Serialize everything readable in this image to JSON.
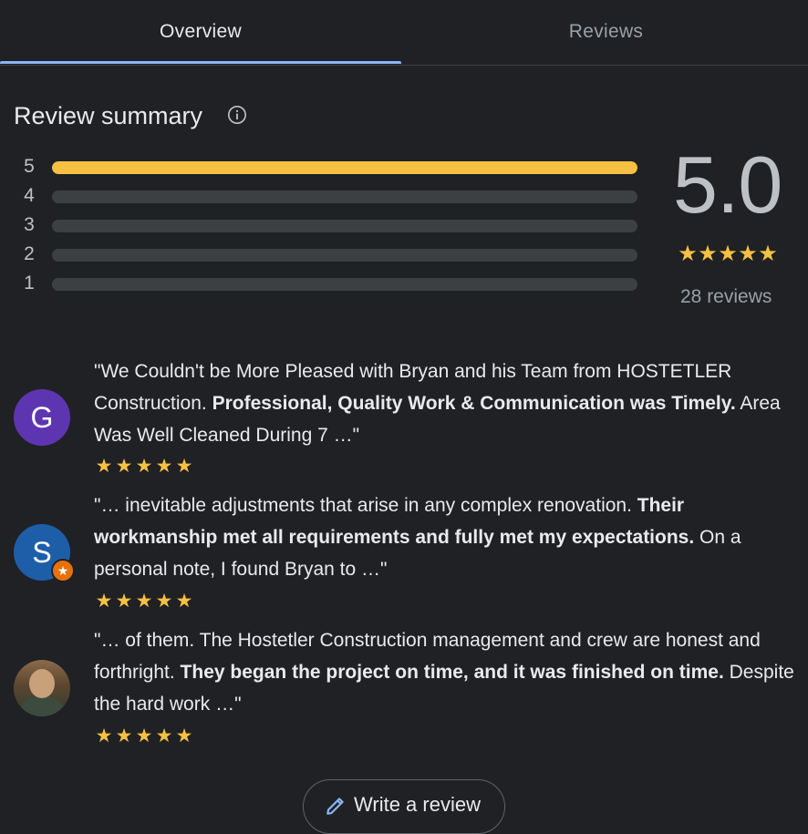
{
  "tabs": [
    {
      "label": "Overview",
      "selected": true
    },
    {
      "label": "Reviews",
      "selected": false
    }
  ],
  "summary": {
    "title": "Review summary",
    "info_icon": "info-icon",
    "rating": "5.0",
    "stars": 5,
    "review_count": "28 reviews",
    "distribution": [
      {
        "label": "5",
        "fraction": 1.0
      },
      {
        "label": "4",
        "fraction": 0
      },
      {
        "label": "3",
        "fraction": 0
      },
      {
        "label": "2",
        "fraction": 0
      },
      {
        "label": "1",
        "fraction": 0
      }
    ],
    "colors": {
      "bar_fill": "#f6c142",
      "bar_track": "#3c4043",
      "star": "#f6c142"
    }
  },
  "reviews": [
    {
      "avatar_letter": "G",
      "avatar_color": "#5e35b1",
      "text_before": "\"We Couldn't be More Pleased with Bryan and his Team from HOSTETLER Construction. ",
      "text_bold": "Professional, Quality Work & Communication was Timely.",
      "text_after": " Area Was Well Cleaned During 7 …\"",
      "stars": 5
    },
    {
      "avatar_letter": "S",
      "avatar_color": "#1e5ea8",
      "badge_icon": "local-guide-badge-icon",
      "text_before": "\"… inevitable adjustments that arise in any complex renovation. ",
      "text_bold": "Their workmanship met all requirements and fully met my expectations.",
      "text_after": " On a personal note, I found Bryan to …\"",
      "stars": 5
    },
    {
      "avatar_letter": "",
      "avatar_icon": "profile-photo",
      "text_before": "\"… of them. The Hostetler Construction management and crew are honest and forthright. ",
      "text_bold": "They began the project on time, and it was finished on time.",
      "text_after": " Despite the hard work …\"",
      "stars": 5
    }
  ],
  "write_review": {
    "label": "Write a review",
    "icon": "pencil-icon",
    "icon_color": "#8ab4f8"
  }
}
